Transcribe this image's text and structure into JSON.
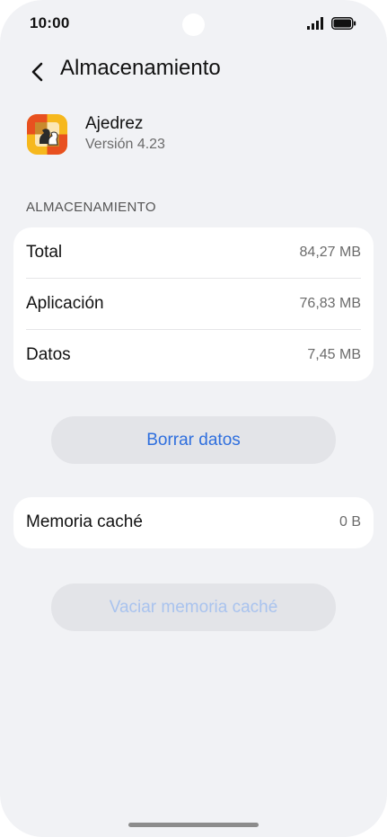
{
  "status_bar": {
    "time": "10:00",
    "signal_icon": "signal-bars-icon",
    "battery_icon": "battery-full-icon"
  },
  "header": {
    "back_icon": "chevron-left-icon",
    "title": "Almacenamiento"
  },
  "app": {
    "icon": "chess-app-icon",
    "name": "Ajedrez",
    "version": "Versión 4.23"
  },
  "storage": {
    "section_label": "ALMACENAMIENTO",
    "rows": [
      {
        "label": "Total",
        "value": "84,27 MB"
      },
      {
        "label": "Aplicación",
        "value": "76,83 MB"
      },
      {
        "label": "Datos",
        "value": "7,45 MB"
      }
    ],
    "clear_data_label": "Borrar datos"
  },
  "cache": {
    "label": "Memoria caché",
    "value": "0 B",
    "clear_cache_label": "Vaciar memoria caché",
    "clear_cache_enabled": false
  },
  "colors": {
    "accent": "#2f6fde",
    "accent_disabled": "#a9c3ee",
    "background": "#f1f2f5"
  }
}
